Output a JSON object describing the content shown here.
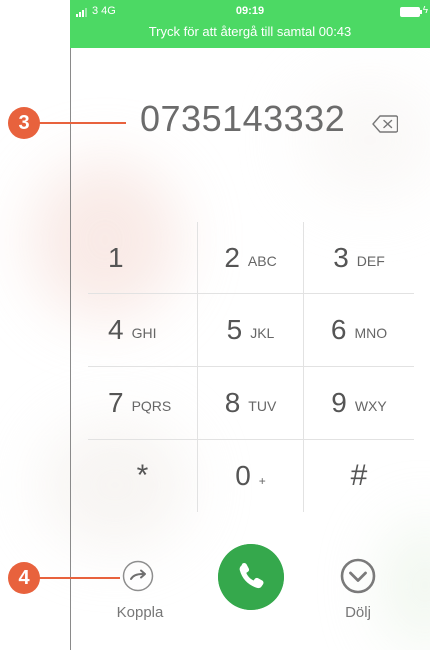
{
  "status_bar": {
    "carrier": "3  4G",
    "time": "09:19",
    "call_banner": "Tryck för att återgå till samtal 00:43",
    "color": "#4cd964"
  },
  "display": {
    "number": "0735143332",
    "backspace_icon": "backspace-icon"
  },
  "annotations": {
    "badge_1": "3",
    "badge_2": "4",
    "color": "#e8623d"
  },
  "keypad": {
    "keys": [
      {
        "digit": "1",
        "letters": ""
      },
      {
        "digit": "2",
        "letters": "ABC"
      },
      {
        "digit": "3",
        "letters": "DEF"
      },
      {
        "digit": "4",
        "letters": "GHI"
      },
      {
        "digit": "5",
        "letters": "JKL"
      },
      {
        "digit": "6",
        "letters": "MNO"
      },
      {
        "digit": "7",
        "letters": "PQRS"
      },
      {
        "digit": "8",
        "letters": "TUV"
      },
      {
        "digit": "9",
        "letters": "WXY"
      },
      {
        "digit": "*",
        "letters": ""
      },
      {
        "digit": "0",
        "letters": "+"
      },
      {
        "digit": "#",
        "letters": ""
      }
    ]
  },
  "controls": {
    "transfer_label": "Koppla",
    "transfer_icon": "arrow-right-circle-icon",
    "call_icon": "phone-icon",
    "call_color": "#35a84c",
    "hide_label": "Dölj",
    "hide_icon": "chevron-down-circle-icon"
  }
}
